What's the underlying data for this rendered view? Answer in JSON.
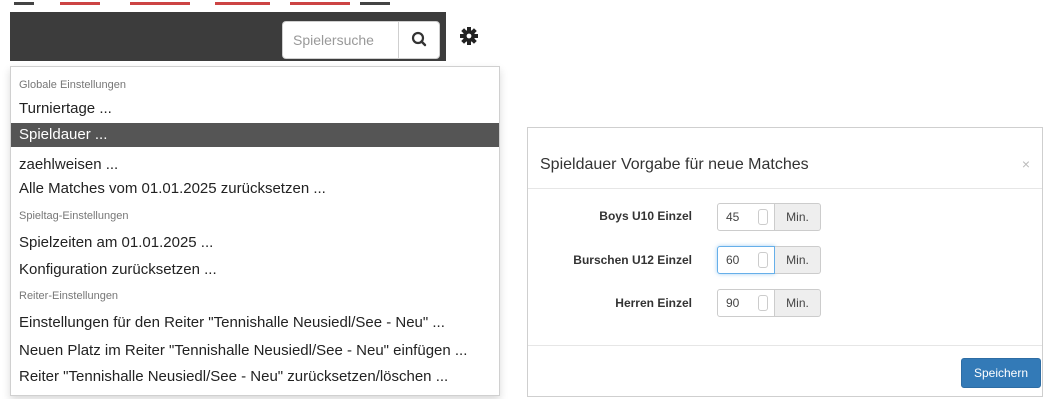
{
  "navbar": {
    "search_placeholder": "Spielersuche",
    "search_icon": "search-icon",
    "settings_icon": "gear-icon",
    "accent_color": "#3c3c3c"
  },
  "menu": {
    "sections": [
      {
        "header": "Globale Einstellungen",
        "items": [
          "Turniertage ...",
          "Spieldauer ...",
          "zaehlweisen ...",
          "Alle Matches vom 01.01.2025 zurücksetzen ..."
        ]
      },
      {
        "header": "Spieltag-Einstellungen",
        "items": [
          "Spielzeiten am 01.01.2025 ...",
          "Konfiguration zurücksetzen ..."
        ]
      },
      {
        "header": "Reiter-Einstellungen",
        "items": [
          "Einstellungen für den Reiter \"Tennishalle Neusiedl/See - Neu\" ...",
          "Neuen Platz im Reiter \"Tennishalle Neusiedl/See - Neu\" einfügen ...",
          "Reiter \"Tennishalle Neusiedl/See - Neu\" zurücksetzen/löschen ..."
        ]
      }
    ],
    "active_item": "Spieldauer ..."
  },
  "modal": {
    "title": "Spieldauer Vorgabe für neue Matches",
    "close": "×",
    "rows": [
      {
        "label": "Boys U10 Einzel",
        "value": "45",
        "unit": "Min."
      },
      {
        "label": "Burschen U12 Einzel",
        "value": "60",
        "unit": "Min."
      },
      {
        "label": "Herren Einzel",
        "value": "90",
        "unit": "Min."
      }
    ],
    "save_label": "Speichern",
    "primary_color": "#337ab7"
  }
}
